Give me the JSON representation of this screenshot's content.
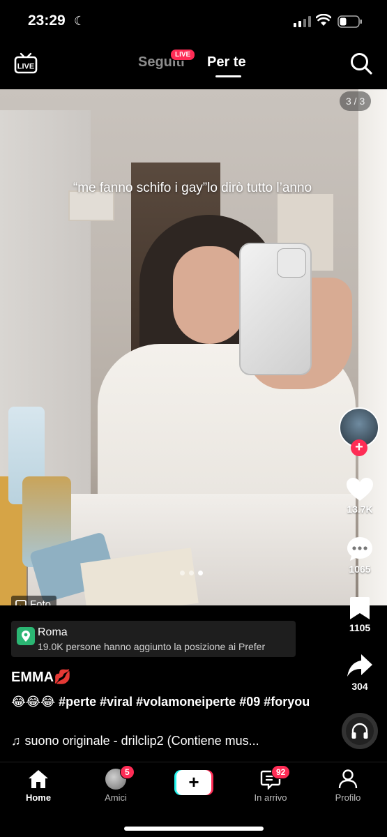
{
  "status_bar": {
    "time": "23:29",
    "moon": "☾"
  },
  "top_nav": {
    "tab_following": "Seguiti",
    "live_badge": "LIVE",
    "tab_for_you": "Per te",
    "live_icon_label": "LIVE"
  },
  "post": {
    "page_counter": "3 / 3",
    "caption": "“me fanno schifo i gay”lo dirò tutto l’anno",
    "photo_label": "Foto",
    "location": {
      "name": "Roma",
      "info": "19.0K persone hanno aggiunto la posizione ai Prefer"
    },
    "username": "EMMA💋",
    "description": "😂😂😂 #perte #viral #volamoneiperte #09 #foryou",
    "sound": "suono originale - drilclip2 (Contiene mus..."
  },
  "actions": {
    "likes": "13.7K",
    "comments": "1065",
    "saves": "1105",
    "shares": "304"
  },
  "bottom_nav": {
    "home": "Home",
    "friends": "Amici",
    "friends_badge": "5",
    "create": "+",
    "inbox": "In arrivo",
    "inbox_badge": "92",
    "profile": "Profilo"
  },
  "colors": {
    "accent": "#fe2c55",
    "cyan": "#25f4ee"
  }
}
